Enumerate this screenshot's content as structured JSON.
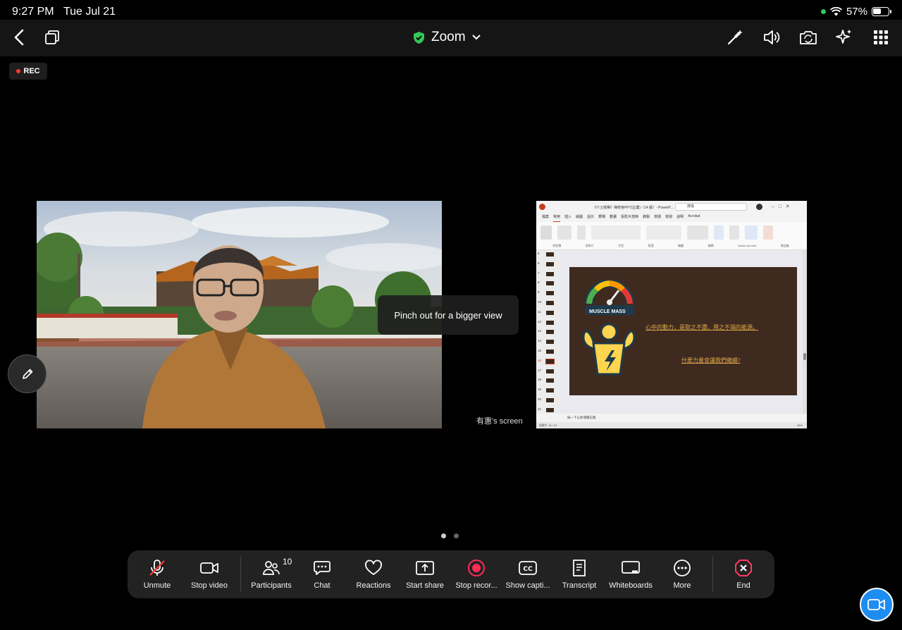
{
  "status_bar": {
    "time": "9:27 PM",
    "date": "Tue Jul 21",
    "battery": "57%"
  },
  "nav": {
    "title": "Zoom"
  },
  "rec_label": "REC",
  "tooltip": "Pinch out for a bigger view",
  "screen_label": "有惠's screen",
  "ppt": {
    "title": "《介士檢稀》禪修身PPT(企業)（14 版）- PowerP...",
    "search": "搜尋",
    "tabs": [
      "檔案",
      "常用",
      "插入",
      "繪圖",
      "設計",
      "轉場",
      "動畫",
      "投影片放映",
      "錄製",
      "校閱",
      "檢視",
      "說明",
      "Acrobat"
    ],
    "ribbon_groups": [
      "剪貼簿",
      "投影片",
      "字型",
      "段落",
      "繪圖",
      "編輯",
      "Adobe Acrobat",
      "增益集"
    ],
    "thumb_numbers": [
      "5",
      "6",
      "7",
      "8",
      "9",
      "10",
      "11",
      "12",
      "13",
      "14",
      "15",
      "16",
      "17",
      "18",
      "19",
      "20",
      "21"
    ],
    "slide_badge": "MUSCLE MASS",
    "slide_line1": "心中的動力，是取之不盡，用之不竭的能源。",
    "slide_line2": "什麼力量會讓我們繼續?",
    "notes": "按一下以新增備忘稿",
    "status_left": "投影片 16 / 21",
    "zoom": "45%"
  },
  "toolbar": [
    {
      "label": "Unmute",
      "icon": "mic-muted-icon"
    },
    {
      "label": "Stop video",
      "icon": "video-camera-icon"
    },
    {
      "label": "Participants",
      "icon": "participants-icon",
      "badge": "10"
    },
    {
      "label": "Chat",
      "icon": "chat-icon"
    },
    {
      "label": "Reactions",
      "icon": "heart-icon"
    },
    {
      "label": "Start share",
      "icon": "share-icon"
    },
    {
      "label": "Stop recor...",
      "icon": "record-icon"
    },
    {
      "label": "Show capti...",
      "icon": "captions-icon"
    },
    {
      "label": "Transcript",
      "icon": "transcript-icon"
    },
    {
      "label": "Whiteboards",
      "icon": "whiteboard-icon"
    },
    {
      "label": "More",
      "icon": "more-icon"
    },
    {
      "label": "End",
      "icon": "end-icon"
    }
  ],
  "colors": {
    "accent": "#1d8df2",
    "end": "#ff3b5c",
    "record": "#ff2d55",
    "shield": "#34c759"
  }
}
